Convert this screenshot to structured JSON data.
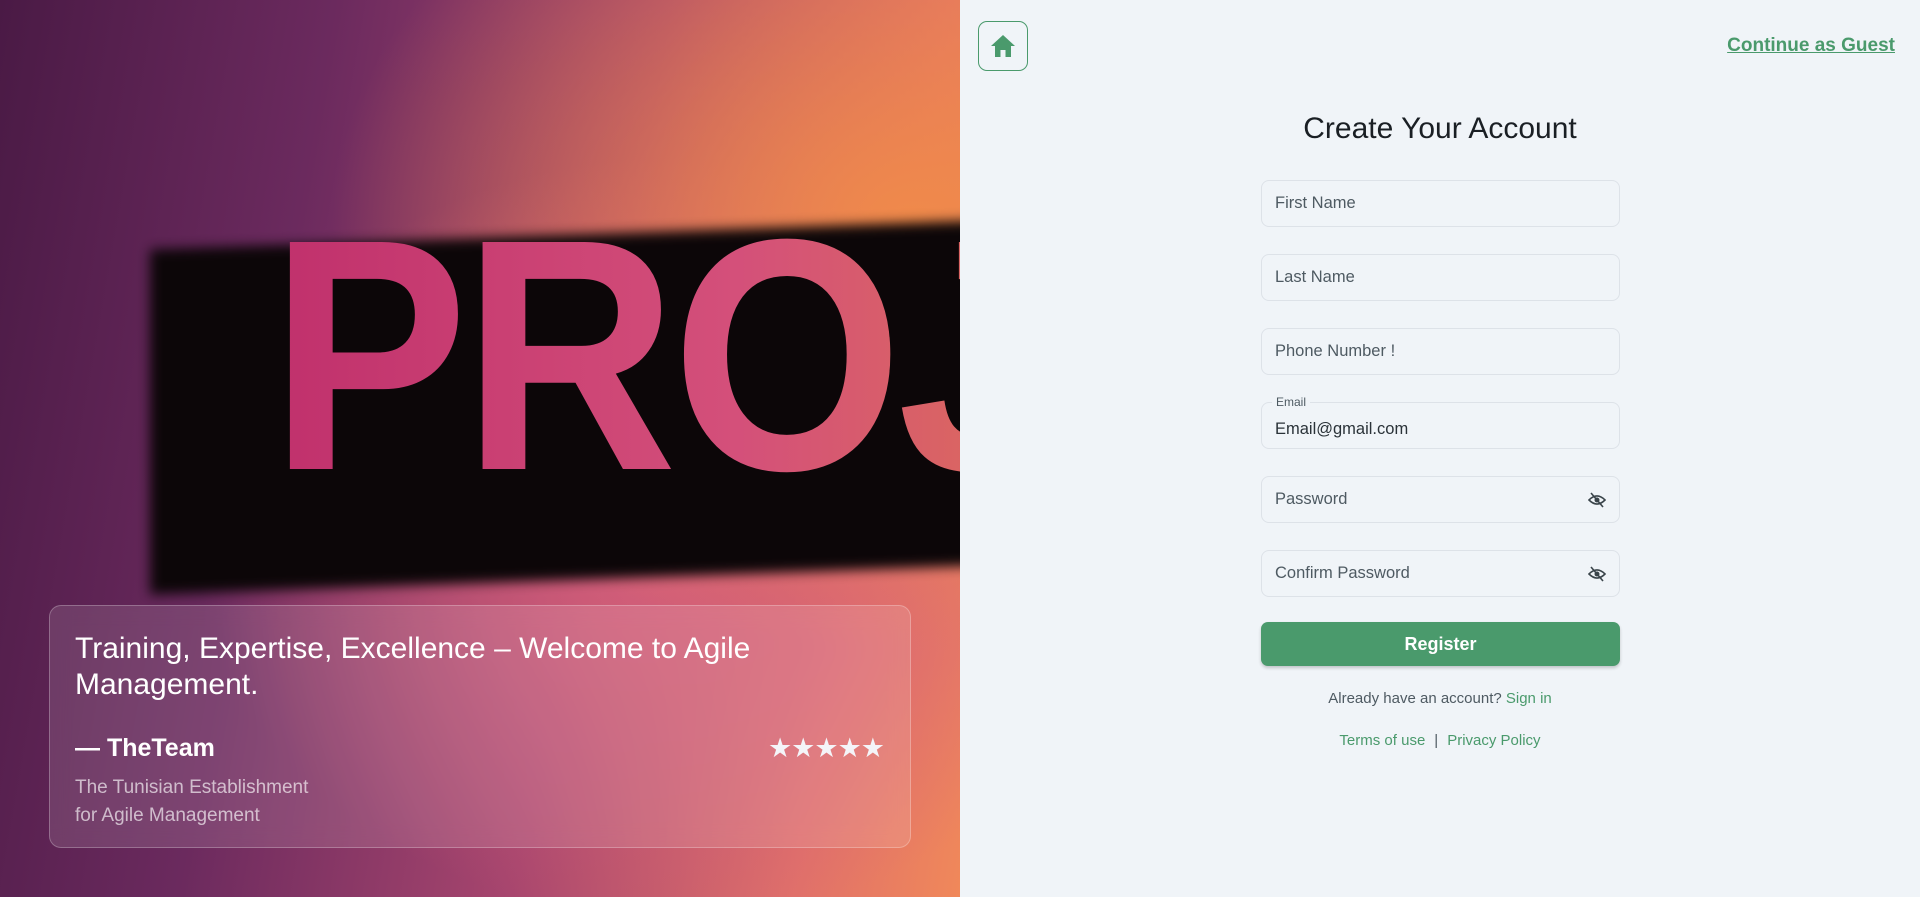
{
  "hero": {
    "photo_word": "PROJECTS",
    "quote": "Training, Expertise, Excellence – Welcome to Agile Management.",
    "author": "— TheTeam",
    "org_line1": "The Tunisian Establishment",
    "org_line2": "for Agile Management",
    "rating": 5,
    "stars": "★★★★★"
  },
  "header": {
    "home_icon": "home-icon",
    "guest_link": "Continue as Guest"
  },
  "form": {
    "title": "Create Your Account",
    "first_name_placeholder": "First Name",
    "last_name_placeholder": "Last Name",
    "phone_placeholder": "Phone Number !",
    "email_label": "Email",
    "email_value": "Email@gmail.com",
    "password_placeholder": "Password",
    "confirm_password_placeholder": "Confirm Password",
    "eye_icon": "eye-off-icon",
    "register_label": "Register",
    "already_text": "Already have an account?",
    "sign_in": "Sign in",
    "terms": "Terms of use",
    "separator": "|",
    "privacy": "Privacy Policy"
  },
  "colors": {
    "accent": "#4a9a6c",
    "background": "#f0f4f8"
  }
}
